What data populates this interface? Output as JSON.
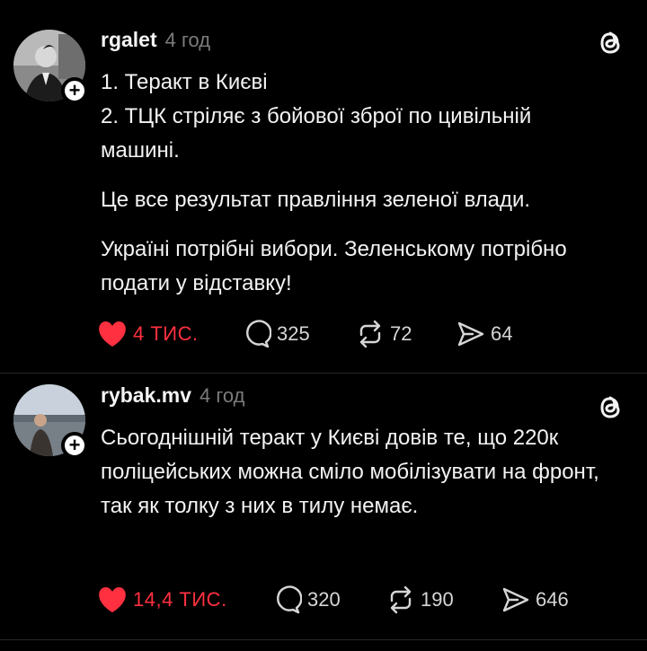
{
  "posts": [
    {
      "username": "rgalet",
      "time": "4 год",
      "paragraphs": [
        "1. Теракт в Києві",
        "2. ТЦК стріляє з бойової зброї по цивільній машині.",
        "Це все результат правління зеленої влади.",
        "Україні потрібні вибори. Зеленському потрібно подати у відставку!"
      ],
      "likes": "4 ТИС.",
      "comments": "325",
      "reposts": "72",
      "shares": "64"
    },
    {
      "username": "rybak.mv",
      "time": "4 год",
      "paragraphs": [
        "Сьогоднішній теракт у Києві довів те, що 220к поліцейських можна сміло мобілізувати на фронт, так як толку з них в тилу немає."
      ],
      "likes": "14,4 ТИС.",
      "comments": "320",
      "reposts": "190",
      "shares": "646"
    }
  ],
  "colors": {
    "like": "#ff3040",
    "muted": "#7c7c7c",
    "background": "#000000"
  },
  "icons": [
    "heart-icon",
    "comment-icon",
    "repost-icon",
    "share-icon",
    "threads-logo-icon",
    "follow-plus-icon"
  ]
}
